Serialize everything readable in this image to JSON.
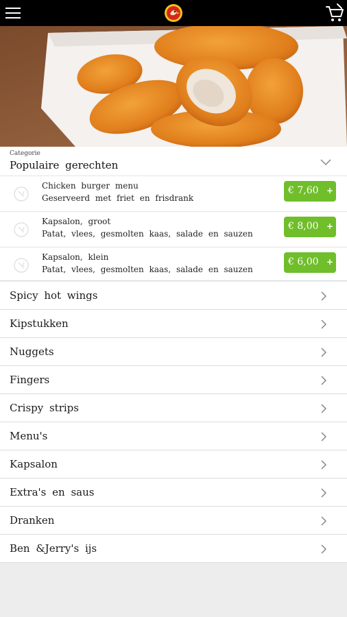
{
  "header": {
    "menu_icon": "hamburger-menu-icon",
    "logo_icon": "restaurant-logo-icon",
    "cart_icon": "shopping-cart-icon"
  },
  "popular": {
    "caption": "Categorie",
    "title": "Populaire gerechten",
    "collapse_icon": "chevron-down-icon",
    "items": [
      {
        "name": "Chicken burger menu",
        "description": "Geserveerd met friet en frisdrank",
        "price": "€ 7,60",
        "add": "+"
      },
      {
        "name": "Kapsalon, groot",
        "description": "Patat, vlees, gesmolten kaas, salade en sauzen",
        "price": "€ 8,00",
        "add": "+"
      },
      {
        "name": "Kapsalon, klein",
        "description": "Patat, vlees, gesmolten kaas, salade en sauzen",
        "price": "€ 6,00",
        "add": "+"
      }
    ]
  },
  "categories": [
    "Spicy hot wings",
    "Kipstukken",
    "Nuggets",
    "Fingers",
    "Crispy strips",
    "Menu's",
    "Kapsalon",
    "Extra's en saus",
    "Dranken",
    "Ben &Jerry's ijs"
  ],
  "colors": {
    "topbar": "#000000",
    "price_button": "#6fbe2a",
    "background": "#ededed"
  }
}
